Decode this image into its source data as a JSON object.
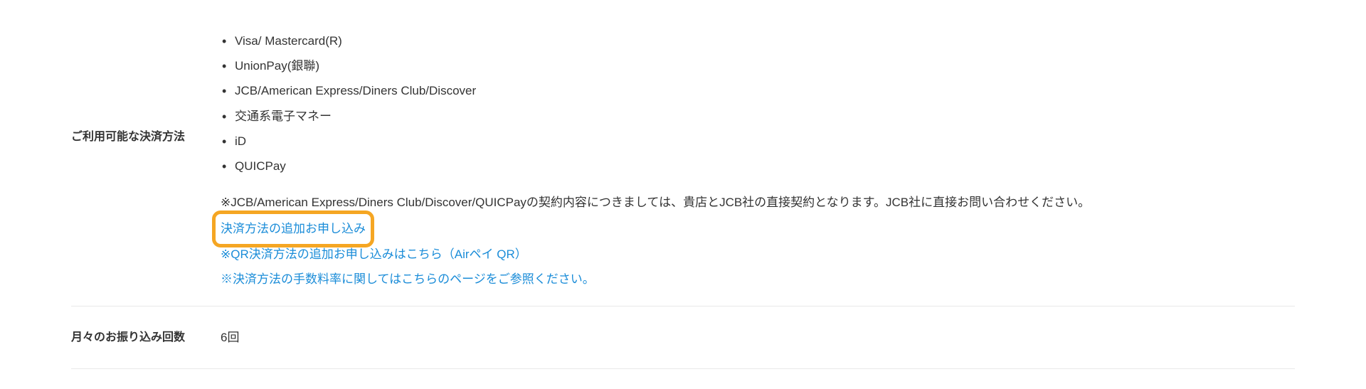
{
  "section1": {
    "label": "ご利用可能な決済方法",
    "items": [
      "Visa/ Mastercard(R)",
      "UnionPay(銀聯)",
      "JCB/American Express/Diners Club/Discover",
      "交通系電子マネー",
      "iD",
      "QUICPay"
    ],
    "note": "※JCB/American Express/Diners Club/Discover/QUICPayの契約内容につきましては、貴店とJCB社の直接契約となります。JCB社に直接お問い合わせください。",
    "links": {
      "add_payment": "決済方法の追加お申し込み",
      "add_qr": "※QR決済方法の追加お申し込みはこちら（Airペイ QR）",
      "fee_info": "※決済方法の手数料率に関してはこちらのページをご参照ください。"
    }
  },
  "section2": {
    "label": "月々のお振り込み回数",
    "value": "6回"
  }
}
